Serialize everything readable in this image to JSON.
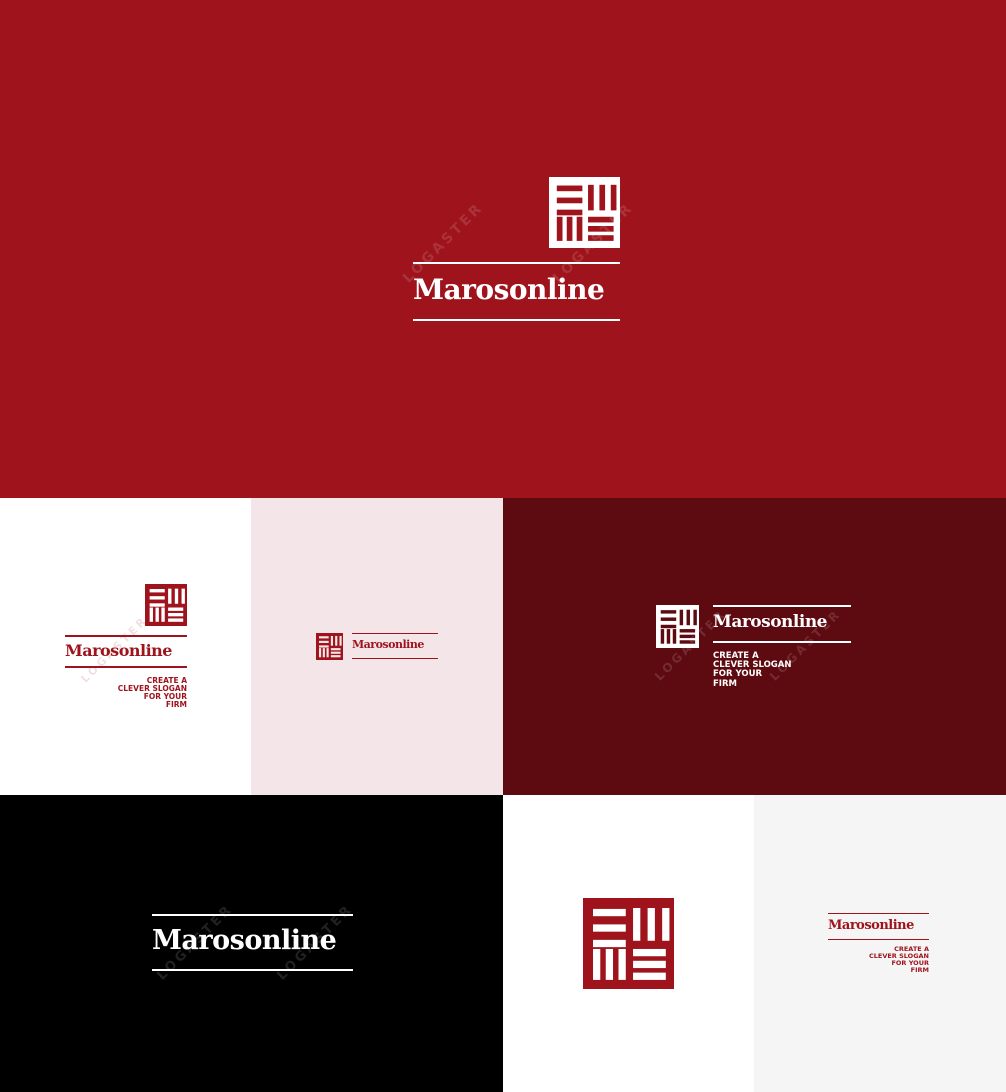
{
  "brand": {
    "name": "Marosonline",
    "slogan_lines": [
      "CREATE A",
      "CLEVER SLOGAN",
      "FOR YOUR",
      "FIRM"
    ],
    "watermark": "LOGASTER"
  },
  "colors": {
    "primary_red": "#9e131c",
    "dark_red": "#5e0a11",
    "light_pink": "#f4e6e8",
    "white": "#ffffff",
    "black": "#000000",
    "light_gray": "#f5f5f5"
  },
  "icons": {
    "logo_mark": "maze-square-icon"
  }
}
